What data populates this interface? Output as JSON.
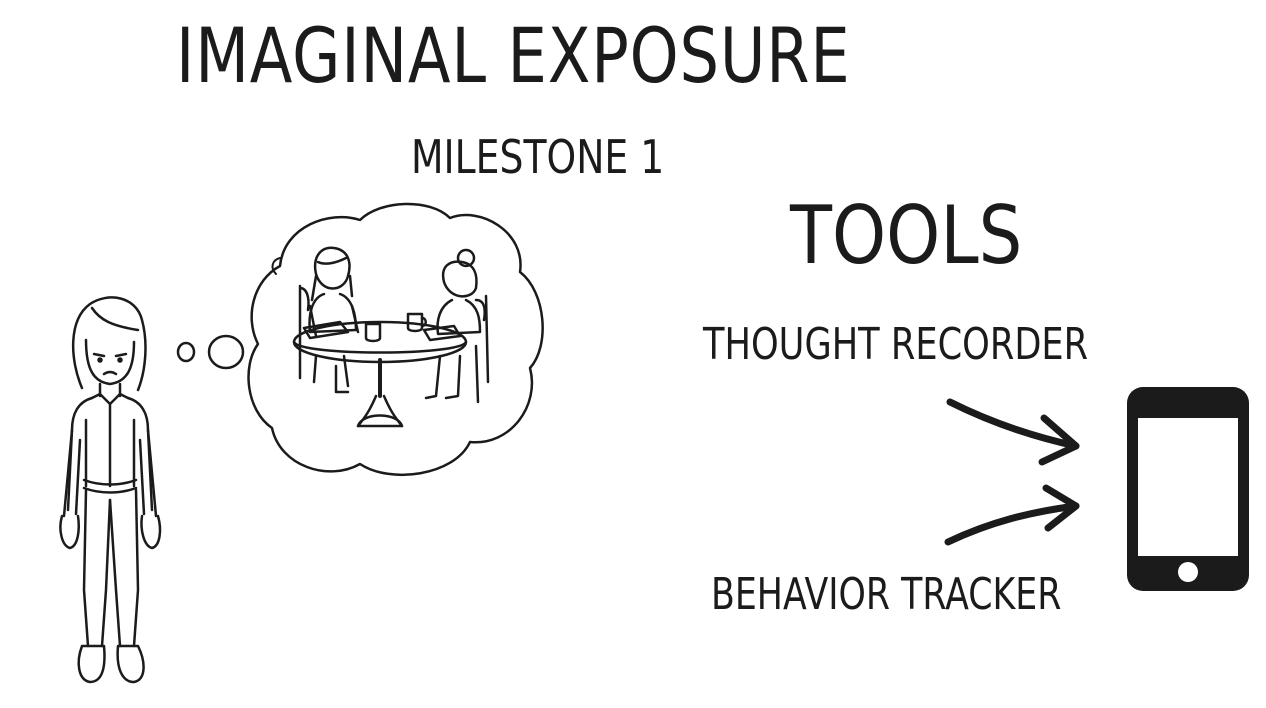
{
  "slide": {
    "title": "IMAGINAL EXPOSURE",
    "subtitle": "MILESTONE 1",
    "tools_heading": "TOOLS",
    "tool_items": [
      "THOUGHT RECORDER",
      "BEHAVIOR TRACKER"
    ]
  },
  "icons": {
    "person": "sad-person-figure",
    "thought": "thought-bubble-two-women-at-table",
    "phone": "smartphone-icon",
    "arrow": "curved-arrow-icon"
  },
  "colors": {
    "ink": "#1b1b1b",
    "background": "#ffffff"
  }
}
